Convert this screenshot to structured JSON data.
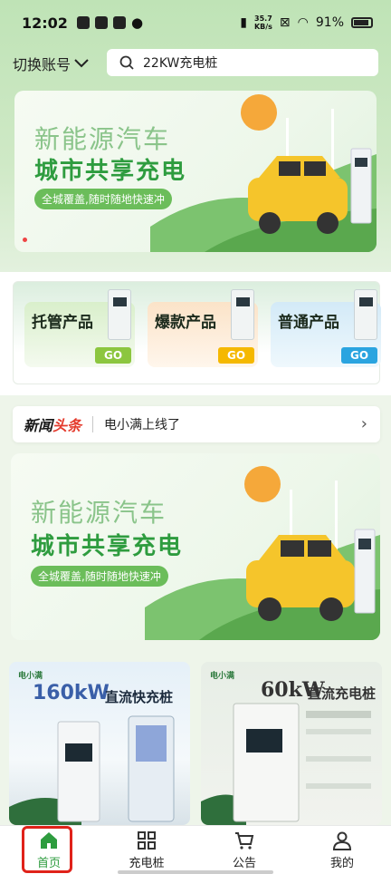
{
  "status_bar": {
    "time": "12:02",
    "network_speed": "35.7",
    "network_unit": "KB/s",
    "battery": "91%"
  },
  "header": {
    "account_switch": "切换账号",
    "search_value": "22KW充电桩"
  },
  "banner1": {
    "title": "新能源汽车",
    "subtitle": "城市共享充电",
    "tag": "全城覆盖,随时随地快速冲"
  },
  "products": [
    {
      "label": "托管产品",
      "go": "GO",
      "color": "#8cc63f"
    },
    {
      "label": "爆款产品",
      "go": "GO",
      "color": "#f5b800"
    },
    {
      "label": "普通产品",
      "go": "GO",
      "color": "#2aa4e0"
    }
  ],
  "news": {
    "logo_a": "新闻",
    "logo_b": "头条",
    "text": "电小满上线了"
  },
  "banner2": {
    "title": "新能源汽车",
    "subtitle": "城市共享充电",
    "tag": "全城覆盖,随时随地快速冲"
  },
  "product_cards": [
    {
      "brand": "电小满",
      "power": "160kW",
      "type": "直流快充桩"
    },
    {
      "brand": "电小满",
      "power": "60kW",
      "type": "直流充电桩"
    }
  ],
  "tabs": [
    {
      "label": "首页",
      "icon": "home-icon",
      "active": true
    },
    {
      "label": "充电桩",
      "icon": "grid-icon",
      "active": false
    },
    {
      "label": "公告",
      "icon": "cart-icon",
      "active": false
    },
    {
      "label": "我的",
      "icon": "user-icon",
      "active": false
    }
  ],
  "colors": {
    "accent": "#2e9c3f",
    "highlight": "#e0221a"
  }
}
